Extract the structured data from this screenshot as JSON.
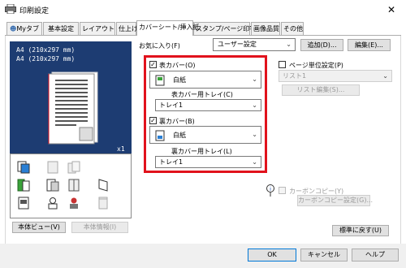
{
  "window": {
    "title": "印刷設定"
  },
  "tabs": [
    {
      "label": "Myタブ"
    },
    {
      "label": "基本設定"
    },
    {
      "label": "レイアウト"
    },
    {
      "label": "仕上げ"
    },
    {
      "label": "カバーシート/挿入紙"
    },
    {
      "label": "スタンプ/ページ印字"
    },
    {
      "label": "画像品質"
    },
    {
      "label": "その他"
    }
  ],
  "preview": {
    "line1": "A4 (210x297 mm)",
    "line2": "A4 (210x297 mm)",
    "copies": "x1"
  },
  "left_buttons": {
    "view": "本体ビュー(V)",
    "info": "本体情報(I)"
  },
  "favorites": {
    "label": "お気に入り(F)",
    "value": "ユーザー設定",
    "add": "追加(D)...",
    "edit": "編集(E)..."
  },
  "front_cover": {
    "label": "表カバー(O)",
    "checked": true,
    "paper": "白紙",
    "tray_label": "表カバー用トレイ(C)",
    "tray_value": "トレイ1"
  },
  "back_cover": {
    "label": "裏カバー(B)",
    "checked": true,
    "paper": "白紙",
    "tray_label": "裏カバー用トレイ(L)",
    "tray_value": "トレイ1"
  },
  "page_unit": {
    "label": "ページ単位設定(P)",
    "list_value": "リスト1",
    "edit_button": "リスト編集(S)..."
  },
  "carbon": {
    "label": "カーボンコピー(Y)",
    "button": "カーボンコピー設定(G)..."
  },
  "reset": "標準に戻す(U)",
  "dialog": {
    "ok": "OK",
    "cancel": "キャンセル",
    "help": "ヘルプ"
  },
  "colors": {
    "highlight": "#e1121c",
    "preview_bg": "#1d3c72",
    "accent": "#0078d7"
  }
}
